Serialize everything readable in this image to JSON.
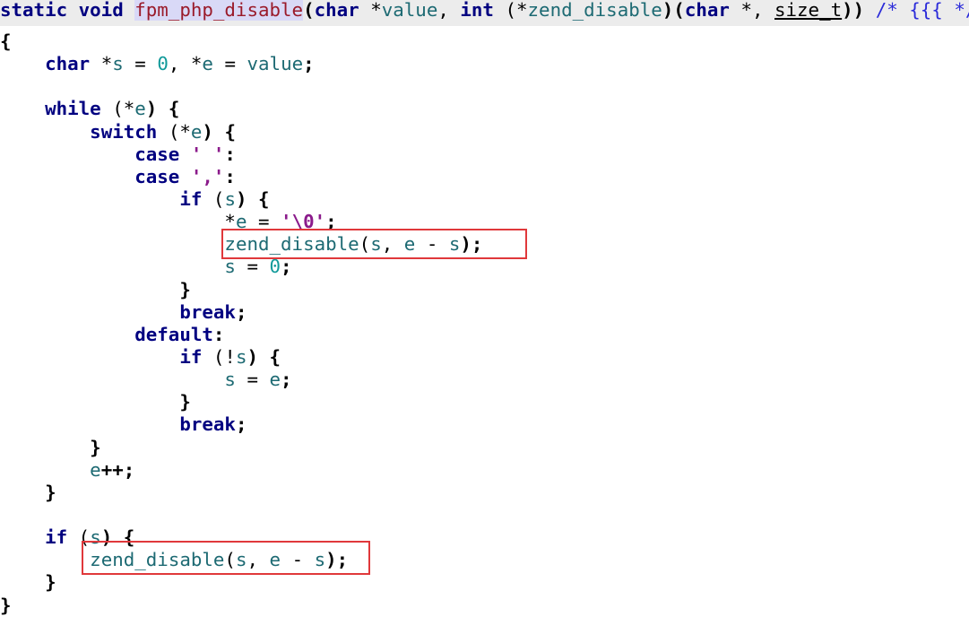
{
  "editor": {
    "lines": [
      [
        [
          "static void ",
          "kw"
        ],
        [
          "fpm_php_disable",
          "fn"
        ],
        [
          "(",
          "pn"
        ],
        [
          "char ",
          "kw"
        ],
        [
          "*",
          ""
        ],
        [
          "value",
          "id"
        ],
        [
          ", ",
          ""
        ],
        [
          "int ",
          "kw"
        ],
        [
          "(*",
          ""
        ],
        [
          "zend_disable",
          "id"
        ],
        [
          ")(",
          "pn"
        ],
        [
          "char ",
          "kw"
        ],
        [
          "*, ",
          ""
        ],
        [
          "size_t",
          "ty"
        ],
        [
          "))",
          "pn"
        ],
        [
          " /* {{{ */",
          "cm"
        ]
      ],
      [
        [
          "{",
          "pn"
        ]
      ],
      [
        [
          "    ",
          ""
        ],
        [
          "char ",
          "kw"
        ],
        [
          "*",
          ""
        ],
        [
          "s",
          "id"
        ],
        [
          " = ",
          ""
        ],
        [
          "0",
          "num"
        ],
        [
          ", *",
          ""
        ],
        [
          "e",
          "id"
        ],
        [
          " = ",
          ""
        ],
        [
          "value",
          "id"
        ],
        [
          ";",
          "pn"
        ]
      ],
      [],
      [
        [
          "    ",
          ""
        ],
        [
          "while ",
          "kw"
        ],
        [
          "(*",
          ""
        ],
        [
          "e",
          "id"
        ],
        [
          ") {",
          "pn"
        ]
      ],
      [
        [
          "        ",
          ""
        ],
        [
          "switch ",
          "kw"
        ],
        [
          "(*",
          ""
        ],
        [
          "e",
          "id"
        ],
        [
          ") {",
          "pn"
        ]
      ],
      [
        [
          "            ",
          ""
        ],
        [
          "case ",
          "kw"
        ],
        [
          "' '",
          "str"
        ],
        [
          ":",
          "pn"
        ]
      ],
      [
        [
          "            ",
          ""
        ],
        [
          "case ",
          "kw"
        ],
        [
          "','",
          "str"
        ],
        [
          ":",
          "pn"
        ]
      ],
      [
        [
          "                ",
          ""
        ],
        [
          "if ",
          "kw"
        ],
        [
          "(",
          ""
        ],
        [
          "s",
          "id"
        ],
        [
          ") {",
          "pn"
        ]
      ],
      [
        [
          "                    ",
          ""
        ],
        [
          "*",
          ""
        ],
        [
          "e",
          "id"
        ],
        [
          " = ",
          ""
        ],
        [
          "'\\0'",
          "str"
        ],
        [
          ";",
          "pn"
        ]
      ],
      [
        [
          "                    ",
          ""
        ],
        [
          "zend_disable",
          "id"
        ],
        [
          "(",
          ""
        ],
        [
          "s",
          "id"
        ],
        [
          ", ",
          ""
        ],
        [
          "e",
          "id"
        ],
        [
          " - ",
          ""
        ],
        [
          "s",
          "id"
        ],
        [
          ");",
          "pn"
        ]
      ],
      [
        [
          "                    ",
          ""
        ],
        [
          "s",
          "id"
        ],
        [
          " = ",
          ""
        ],
        [
          "0",
          "num"
        ],
        [
          ";",
          "pn"
        ]
      ],
      [
        [
          "                ",
          ""
        ],
        [
          "}",
          "pn"
        ]
      ],
      [
        [
          "                ",
          ""
        ],
        [
          "break",
          "kw"
        ],
        [
          ";",
          "pn"
        ]
      ],
      [
        [
          "            ",
          ""
        ],
        [
          "default",
          "kw"
        ],
        [
          ":",
          "pn"
        ]
      ],
      [
        [
          "                ",
          ""
        ],
        [
          "if ",
          "kw"
        ],
        [
          "(!",
          ""
        ],
        [
          "s",
          "id"
        ],
        [
          ") {",
          "pn"
        ]
      ],
      [
        [
          "                    ",
          ""
        ],
        [
          "s",
          "id"
        ],
        [
          " = ",
          ""
        ],
        [
          "e",
          "id"
        ],
        [
          ";",
          "pn"
        ]
      ],
      [
        [
          "                ",
          ""
        ],
        [
          "}",
          "pn"
        ]
      ],
      [
        [
          "                ",
          ""
        ],
        [
          "break",
          "kw"
        ],
        [
          ";",
          "pn"
        ]
      ],
      [
        [
          "        ",
          ""
        ],
        [
          "}",
          "pn"
        ]
      ],
      [
        [
          "        ",
          ""
        ],
        [
          "e",
          "id"
        ],
        [
          "++;",
          "pn"
        ]
      ],
      [
        [
          "    ",
          ""
        ],
        [
          "}",
          "pn"
        ]
      ],
      [],
      [
        [
          "    ",
          ""
        ],
        [
          "if ",
          "kw"
        ],
        [
          "(",
          ""
        ],
        [
          "s",
          "id"
        ],
        [
          ") {",
          "pn"
        ]
      ],
      [
        [
          "        ",
          ""
        ],
        [
          "zend_disable",
          "id"
        ],
        [
          "(",
          ""
        ],
        [
          "s",
          "id"
        ],
        [
          ", ",
          ""
        ],
        [
          "e",
          "id"
        ],
        [
          " - ",
          ""
        ],
        [
          "s",
          "id"
        ],
        [
          ");",
          "pn"
        ]
      ],
      [
        [
          "    ",
          ""
        ],
        [
          "}",
          "pn"
        ]
      ],
      [
        [
          "}",
          "pn"
        ]
      ]
    ]
  },
  "annotations": {
    "highlight_color": "#e0383b"
  }
}
